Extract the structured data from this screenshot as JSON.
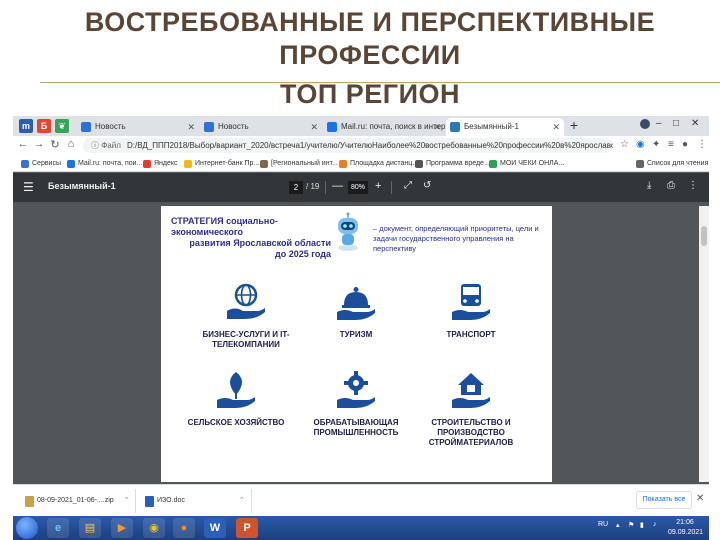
{
  "slide": {
    "title_line1": "ВОСТРЕБОВАННЫЕ И ПЕРСПЕКТИВНЫЕ",
    "title_line2": "ПРОФЕССИИ",
    "title_line3": "ТОП РЕГИОН"
  },
  "browser": {
    "tabs": [
      {
        "label": "Новость"
      },
      {
        "label": "Новость"
      },
      {
        "label": "Mail.ru: почта, поиск в интерне"
      },
      {
        "label": "Безымянный-1"
      }
    ],
    "new_tab": "+",
    "window_controls": [
      "–",
      "□",
      "✕"
    ],
    "url_info": "ⓘ Файл",
    "url": "D:/ВД_ППП2018/Выбор/вариант_2020/встреча1/учителю/УчителюНаиболее%20востребованные%20профессии%20в%20ярославской%20обла...",
    "bookmarks": [
      {
        "label": "Сервисы",
        "color": "#3c6fd1"
      },
      {
        "label": "Mail.ru: почта, пои...",
        "color": "#1a73e8"
      },
      {
        "label": "Яндекс",
        "color": "#e33b2e"
      },
      {
        "label": "Интернет-банк Пр...",
        "color": "#f2b51b"
      },
      {
        "label": "[Региональный инт...",
        "color": "#7a6a4f"
      },
      {
        "label": "Площадка дистанц...",
        "color": "#e67e22"
      },
      {
        "label": "Программа вреде...",
        "color": "#555555"
      },
      {
        "label": "МОИ ЧЕКИ ОНЛА...",
        "color": "#2e9e57"
      },
      {
        "label": "Список для чтения",
        "color": "#666666"
      }
    ]
  },
  "pdf": {
    "title": "Безымянный-1",
    "page_current": "2",
    "page_total": "/ 19",
    "zoom_minus": "—",
    "zoom_value": "80%",
    "zoom_plus": "+"
  },
  "doc": {
    "strategy_title_1": "СТРАТЕГИЯ социально-экономического",
    "strategy_title_2": "развития Ярославской области",
    "strategy_title_3": "до 2025 года",
    "strategy_desc": "– документ, определяющий приоритеты, цели и задачи государственного управления на перспективу",
    "items": [
      {
        "label": "БИЗНЕС-УСЛУГИ И IT-ТЕЛЕКОМПАНИИ",
        "icon": "globe-hand-icon"
      },
      {
        "label": "ТУРИЗМ",
        "icon": "service-bell-icon"
      },
      {
        "label": "ТРАНСПОРТ",
        "icon": "bus-icon"
      },
      {
        "label": "СЕЛЬСКОЕ ХОЗЯЙСТВО",
        "icon": "leaf-icon"
      },
      {
        "label": "ОБРАБАТЫВАЮЩАЯ ПРОМЫШЛЕННОСТЬ",
        "icon": "gear-icon"
      },
      {
        "label": "СТРОИТЕЛЬСТВО И ПРОИЗВОДСТВО СТРОЙМАТЕРИАЛОВ",
        "icon": "house-icon"
      }
    ],
    "brand_color": "#2e2d8e",
    "icon_color": "#1b4f9c"
  },
  "downloads": {
    "items": [
      {
        "label": "08-09-2021_01-06-....zip",
        "color": "#c8a24a"
      },
      {
        "label": "ИЗО.doc",
        "color": "#2b5fb8"
      }
    ],
    "show_all": "Показать все"
  },
  "taskbar": {
    "lang": "RU",
    "time": "21:06",
    "date": "09.09.2021"
  }
}
